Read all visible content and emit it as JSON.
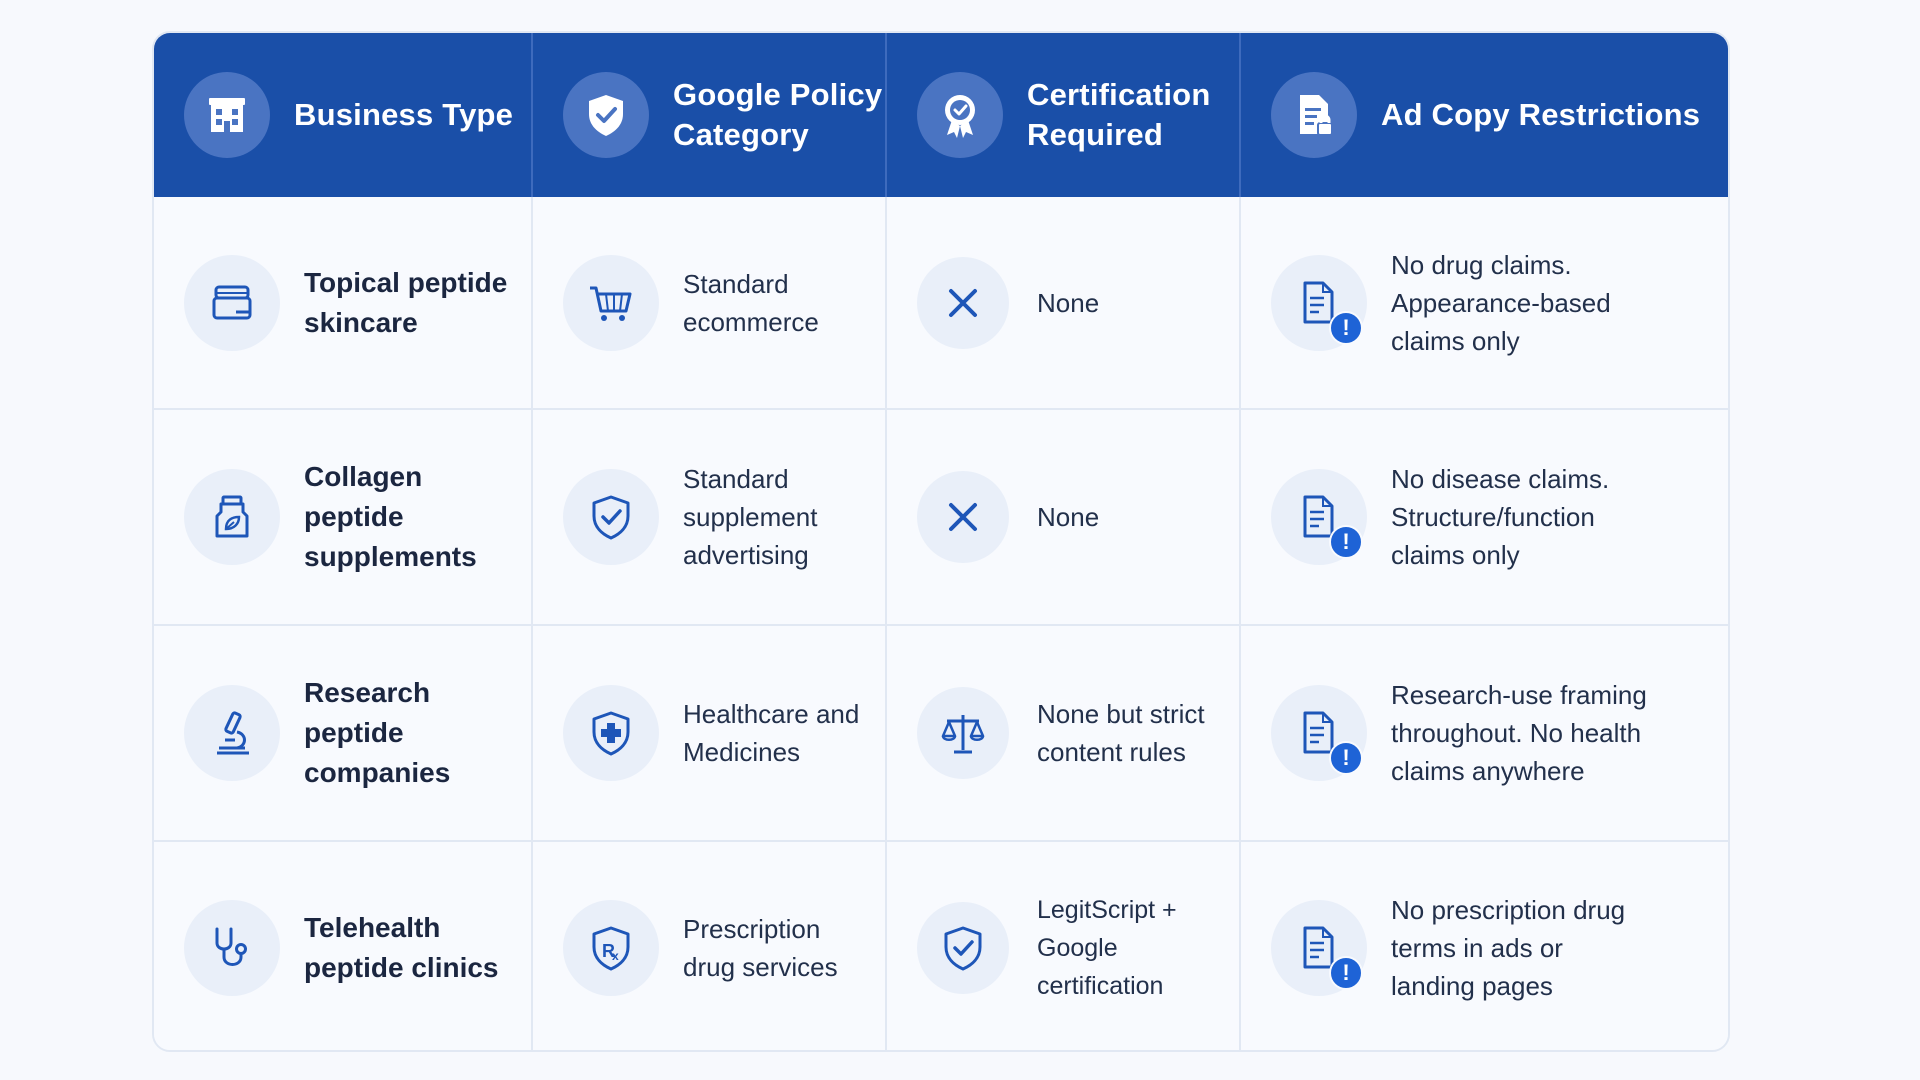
{
  "header": {
    "business_type": "Business Type",
    "policy_category": [
      "Google Policy",
      "Category"
    ],
    "certification": [
      "Certification",
      "Required"
    ],
    "ad_copy": "Ad Copy Restrictions"
  },
  "icons": {
    "header": [
      "building-icon",
      "shield-check-icon",
      "award-badge-icon",
      "document-lock-icon"
    ]
  },
  "rows": [
    {
      "business_type": [
        "Topical peptide",
        "skincare"
      ],
      "business_icon": "cream-jar-icon",
      "policy_category": [
        "Standard",
        "ecommerce"
      ],
      "policy_icon": "shopping-cart-icon",
      "certification": [
        "None"
      ],
      "certification_icon": "x-icon",
      "ad_copy": [
        "No drug claims.",
        "Appearance-based",
        "claims only"
      ]
    },
    {
      "business_type": [
        "Collagen",
        "peptide",
        "supplements"
      ],
      "business_icon": "supplement-bottle-icon",
      "policy_category": [
        "Standard",
        "supplement",
        "advertising"
      ],
      "policy_icon": "shield-check-icon",
      "certification": [
        "None"
      ],
      "certification_icon": "x-icon",
      "ad_copy": [
        "No disease claims.",
        "Structure/function",
        "claims only"
      ]
    },
    {
      "business_type": [
        "Research",
        "peptide",
        "companies"
      ],
      "business_icon": "microscope-icon",
      "policy_category": [
        "Healthcare and",
        "Medicines"
      ],
      "policy_icon": "shield-plus-icon",
      "certification": [
        "None but strict",
        "content rules"
      ],
      "certification_icon": "scales-icon",
      "ad_copy": [
        "Research-use framing",
        "throughout. No health",
        "claims anywhere"
      ]
    },
    {
      "business_type": [
        "Telehealth",
        "peptide clinics"
      ],
      "business_icon": "stethoscope-icon",
      "policy_category": [
        "Prescription",
        "drug services"
      ],
      "policy_icon": "shield-rx-icon",
      "certification": [
        "LegitScript +",
        "Google certification"
      ],
      "certification_icon": "shield-check-icon",
      "ad_copy": [
        "No prescription drug",
        "terms in ads or",
        "landing pages"
      ]
    }
  ],
  "colors": {
    "header_bg": "#1a4fa8",
    "accent": "#1e63d6",
    "icon_circle": "#e9eff9"
  }
}
